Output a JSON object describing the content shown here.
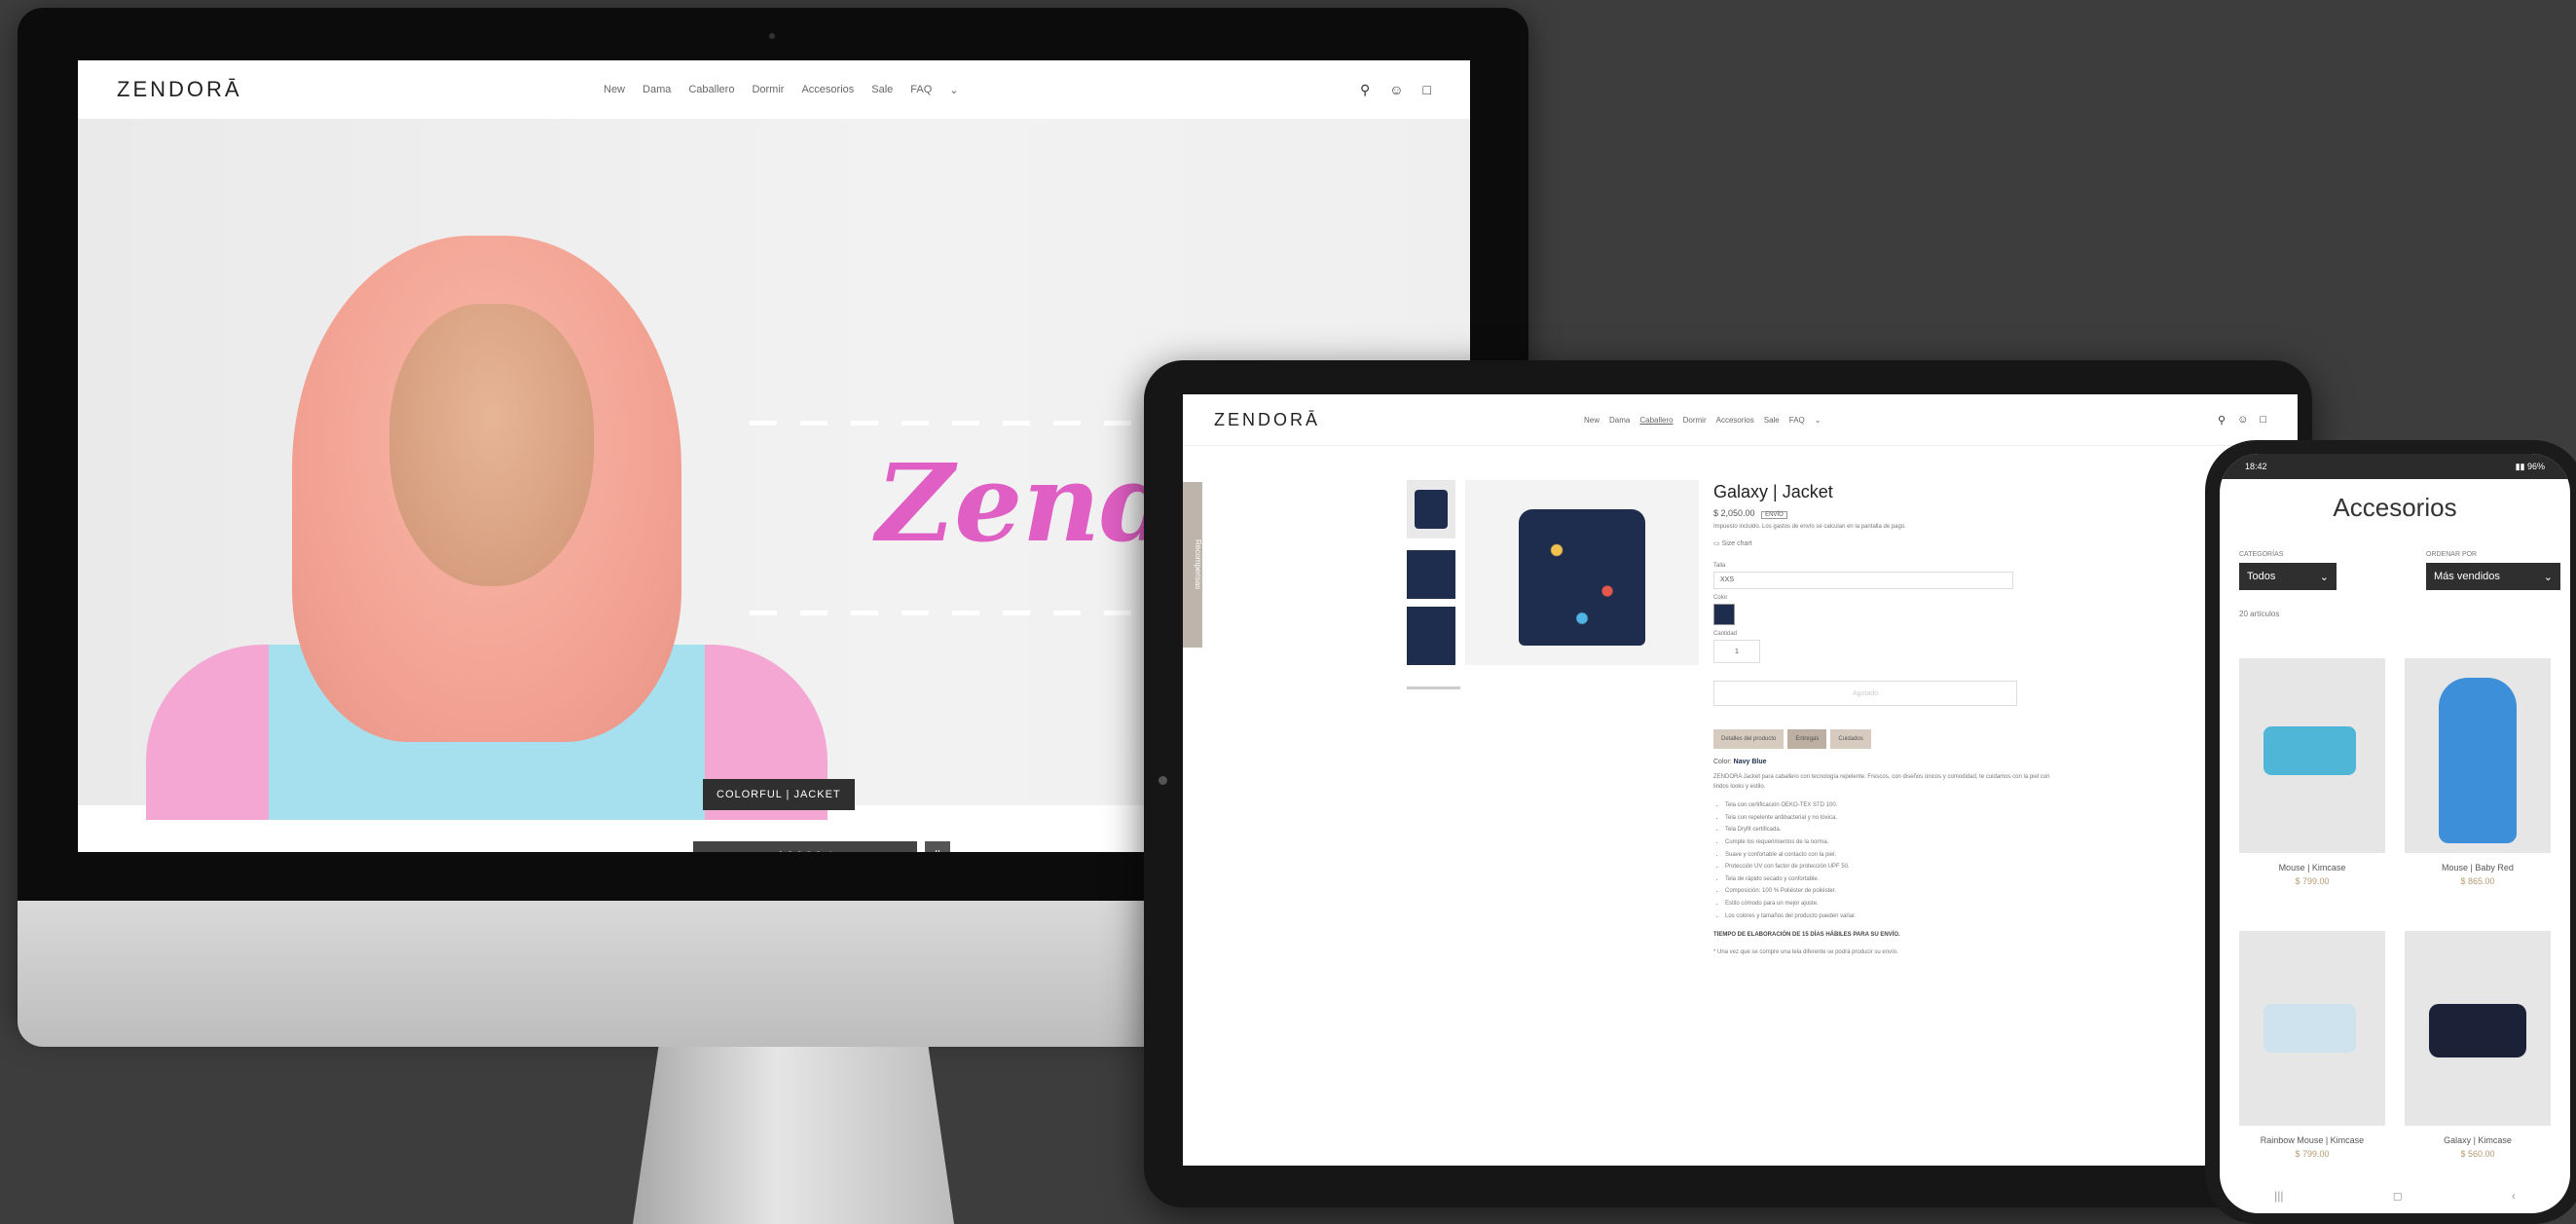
{
  "store": {
    "logo": "ZENDORĀ",
    "nav": [
      "New",
      "Dama",
      "Caballero",
      "Dormir",
      "Accesorios",
      "Sale",
      "FAQ",
      "⌄"
    ],
    "colors": {
      "accent": "#e05fc4",
      "dark": "#2f2f2f"
    }
  },
  "desktop": {
    "hero_script": "Zendor",
    "caption": "COLORFUL | JACKET",
    "slider_next": "›",
    "slider_pause": "II"
  },
  "tablet": {
    "product_title": "Galaxy | Jacket",
    "price": "$ 2,050.00",
    "badge": "ENVÍO",
    "tax_note": "Impuesto incluido. Los gastos de envío se calculan en la pantalla de pago.",
    "size_chart": "Size chart",
    "size_label": "Talla",
    "size_value": "XXS",
    "color_label": "Color",
    "qty_label": "Cantidad",
    "qty_value": "1",
    "add_button": "Agotado",
    "tabs": [
      "Detalles del producto",
      "Entregas",
      "Cuidados"
    ],
    "color_note_label": "Color:",
    "color_note_value": "Navy Blue",
    "description": "ZENDORA Jacket para caballero con tecnología repelente. Frescos, con diseños únicos y comodidad, te cuidamos con la piel con lindos looks y estilo.",
    "bullets": [
      "Tela con certificación OEKO-TEX STD 100.",
      "Tela con repelente antibacterial y no tóxica.",
      "Tela Dryfit certificada.",
      "Cumple los requerimientos de la norma.",
      "Suave y confortable al contacto con la piel.",
      "Protección UV con factor de protección UPF 50.",
      "Tela de rápido secado y confortable.",
      "Composición: 100 % Poliéster de poliéster.",
      "Estilo cómodo para un mejor ajuste.",
      "Los colores y tamaños del producto pueden variar."
    ],
    "delivery_note": "TIEMPO DE ELABORACIÓN DE 15 DÍAS HÁBILES PARA SU ENVÍO.",
    "footer_note": "* Una vez que se compre una tela diferente se podrá producir su envío.",
    "side_tab": "Recompensas"
  },
  "phone": {
    "time": "18:42",
    "status": "▮▮ 96%",
    "title": "Accesorios",
    "filter_label": "CATEGORÍAS",
    "filter_value": "Todos",
    "sort_label": "ORDENAR POR",
    "sort_value": "Más vendidos",
    "count": "20 artículos",
    "products": [
      {
        "name": "Mouse | Kimcase",
        "price": "$ 799.00"
      },
      {
        "name": "Mouse | Baby Red",
        "price": "$ 865.00"
      },
      {
        "name": "Rainbow Mouse | Kimcase",
        "price": "$ 799.00"
      },
      {
        "name": "Galaxy | Kimcase",
        "price": "$ 560.00"
      }
    ],
    "nav_buttons": [
      "|||",
      "◻",
      "‹"
    ]
  }
}
